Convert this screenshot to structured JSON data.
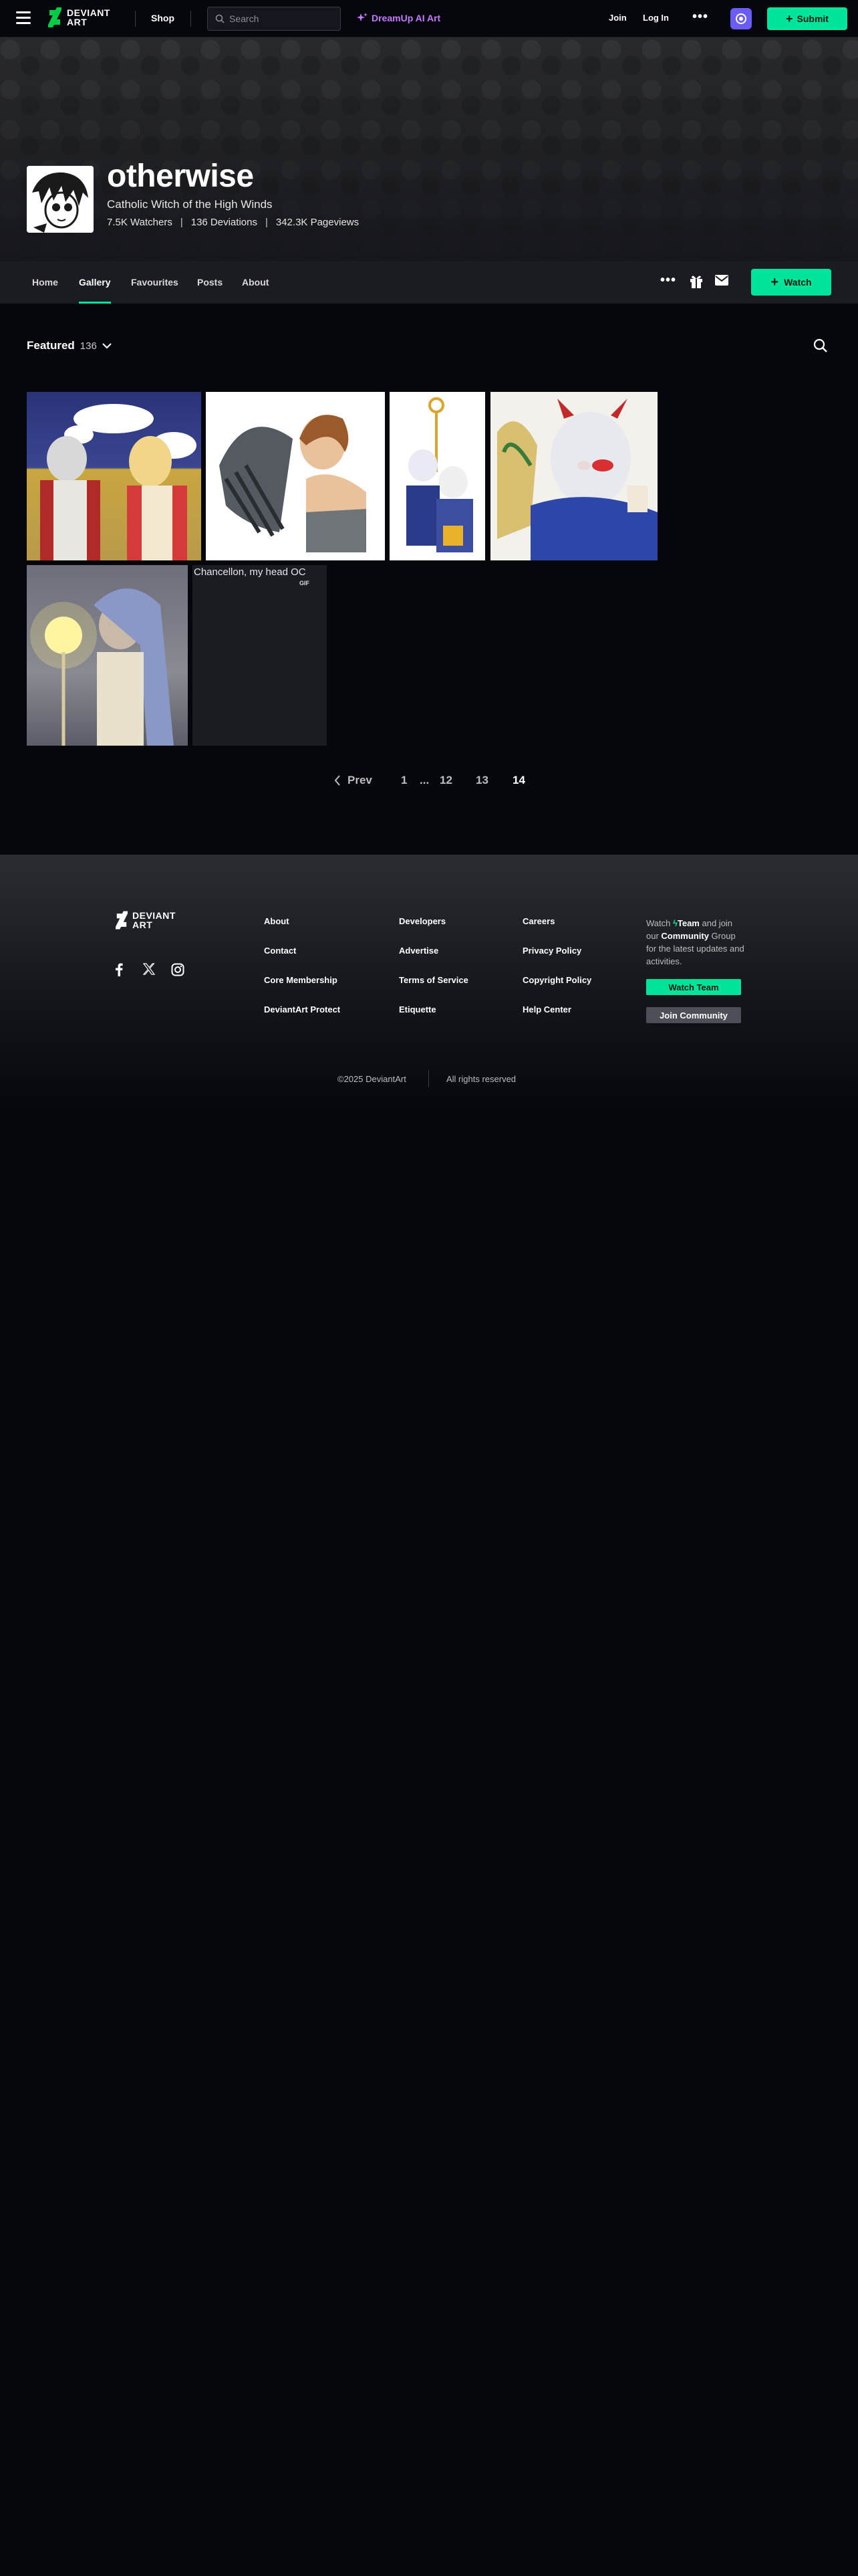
{
  "topbar": {
    "logo_line1": "DEVIANT",
    "logo_line2": "ART",
    "shop": "Shop",
    "search_placeholder": "Search",
    "dreamup": "DreamUp AI Art",
    "join": "Join",
    "login": "Log In",
    "submit": "Submit",
    "accent_color": "#00e59b"
  },
  "profile": {
    "name": "otherwise",
    "tagline": "Catholic Witch of the High Winds",
    "watchers": "7.5K Watchers",
    "deviations": "136 Deviations",
    "pageviews": "342.3K Pageviews"
  },
  "nav": {
    "tabs": [
      "Home",
      "Gallery",
      "Favourites",
      "Posts",
      "About"
    ],
    "active": "Gallery",
    "watch": "Watch"
  },
  "gallery": {
    "title": "Featured",
    "count": "136",
    "thumb6_alt": "Chancellon, my head OC",
    "thumb6_badge": "GIF"
  },
  "pagination": {
    "prev": "Prev",
    "pages": [
      "1",
      "...",
      "12",
      "13",
      "14"
    ],
    "current": "14"
  },
  "footer": {
    "logo_line1": "DEVIANT",
    "logo_line2": "ART",
    "col1": [
      "About",
      "Contact",
      "Core Membership",
      "DeviantArt Protect"
    ],
    "col2": [
      "Developers",
      "Advertise",
      "Terms of Service",
      "Etiquette"
    ],
    "col3": [
      "Careers",
      "Privacy Policy",
      "Copyright Policy",
      "Help Center"
    ],
    "watch_text_1": "Watch",
    "watch_team": "Team",
    "watch_text_2": "and join our",
    "watch_community": "Community",
    "watch_text_3": "Group for the latest updates and activities.",
    "watch_team_btn": "Watch Team",
    "join_community_btn": "Join Community",
    "copyright": "©2025 DeviantArt",
    "rights": "All rights reserved",
    "social": [
      "facebook-icon",
      "x-icon",
      "instagram-icon"
    ]
  }
}
